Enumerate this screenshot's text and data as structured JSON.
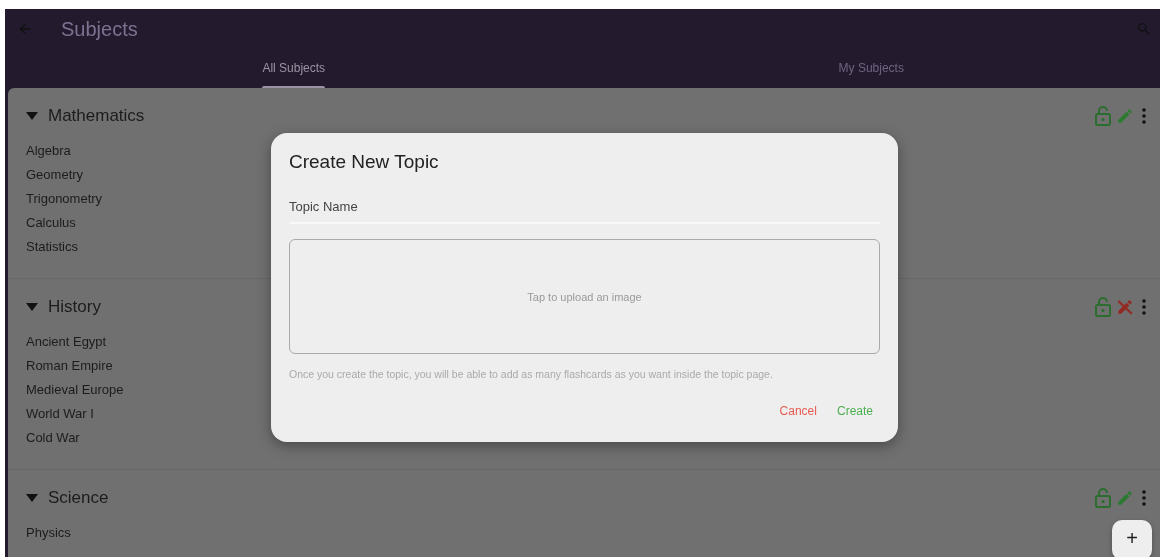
{
  "app_bar": {
    "title": "Subjects"
  },
  "tabs": [
    {
      "label": "All Subjects",
      "selected": true
    },
    {
      "label": "My Subjects",
      "selected": false
    }
  ],
  "subjects": [
    {
      "name": "Mathematics",
      "expanded": true,
      "locked": false,
      "editable": true,
      "topics": [
        "Algebra",
        "Geometry",
        "Trigonometry",
        "Calculus",
        "Statistics"
      ]
    },
    {
      "name": "History",
      "expanded": true,
      "locked": false,
      "editable": false,
      "topics": [
        "Ancient Egypt",
        "Roman Empire",
        "Medieval Europe",
        "World War I",
        "Cold War"
      ]
    },
    {
      "name": "Science",
      "expanded": true,
      "locked": false,
      "editable": true,
      "topics": [
        "Physics"
      ]
    }
  ],
  "dialog": {
    "title": "Create New Topic",
    "field": {
      "placeholder": "Topic Name"
    },
    "upload_hint": "Tap to upload an image",
    "note": "Once you create the topic, you will be able to add as many flashcards as you want inside the topic page.",
    "buttons": [
      {
        "label": "Cancel",
        "kind": "cancel"
      },
      {
        "label": "Create",
        "kind": "confirm"
      }
    ]
  },
  "fab": {
    "label": "+"
  }
}
